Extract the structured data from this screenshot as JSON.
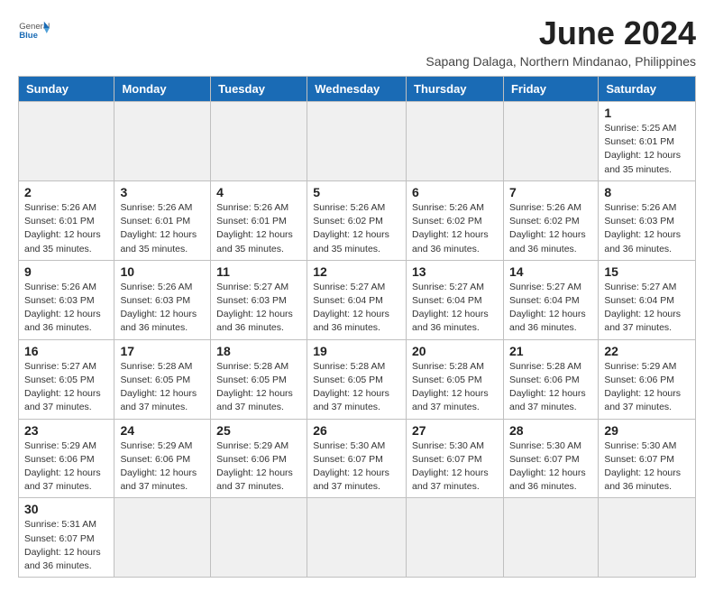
{
  "header": {
    "logo_general": "General",
    "logo_blue": "Blue",
    "month_title": "June 2024",
    "subtitle": "Sapang Dalaga, Northern Mindanao, Philippines"
  },
  "days_of_week": [
    "Sunday",
    "Monday",
    "Tuesday",
    "Wednesday",
    "Thursday",
    "Friday",
    "Saturday"
  ],
  "weeks": [
    [
      {
        "day": "",
        "empty": true
      },
      {
        "day": "",
        "empty": true
      },
      {
        "day": "",
        "empty": true
      },
      {
        "day": "",
        "empty": true
      },
      {
        "day": "",
        "empty": true
      },
      {
        "day": "",
        "empty": true
      },
      {
        "day": "1",
        "sunrise": "5:25 AM",
        "sunset": "6:01 PM",
        "daylight": "12 hours and 35 minutes."
      }
    ],
    [
      {
        "day": "2",
        "sunrise": "5:26 AM",
        "sunset": "6:01 PM",
        "daylight": "12 hours and 35 minutes."
      },
      {
        "day": "3",
        "sunrise": "5:26 AM",
        "sunset": "6:01 PM",
        "daylight": "12 hours and 35 minutes."
      },
      {
        "day": "4",
        "sunrise": "5:26 AM",
        "sunset": "6:01 PM",
        "daylight": "12 hours and 35 minutes."
      },
      {
        "day": "5",
        "sunrise": "5:26 AM",
        "sunset": "6:02 PM",
        "daylight": "12 hours and 35 minutes."
      },
      {
        "day": "6",
        "sunrise": "5:26 AM",
        "sunset": "6:02 PM",
        "daylight": "12 hours and 36 minutes."
      },
      {
        "day": "7",
        "sunrise": "5:26 AM",
        "sunset": "6:02 PM",
        "daylight": "12 hours and 36 minutes."
      },
      {
        "day": "8",
        "sunrise": "5:26 AM",
        "sunset": "6:03 PM",
        "daylight": "12 hours and 36 minutes."
      }
    ],
    [
      {
        "day": "9",
        "sunrise": "5:26 AM",
        "sunset": "6:03 PM",
        "daylight": "12 hours and 36 minutes."
      },
      {
        "day": "10",
        "sunrise": "5:26 AM",
        "sunset": "6:03 PM",
        "daylight": "12 hours and 36 minutes."
      },
      {
        "day": "11",
        "sunrise": "5:27 AM",
        "sunset": "6:03 PM",
        "daylight": "12 hours and 36 minutes."
      },
      {
        "day": "12",
        "sunrise": "5:27 AM",
        "sunset": "6:04 PM",
        "daylight": "12 hours and 36 minutes."
      },
      {
        "day": "13",
        "sunrise": "5:27 AM",
        "sunset": "6:04 PM",
        "daylight": "12 hours and 36 minutes."
      },
      {
        "day": "14",
        "sunrise": "5:27 AM",
        "sunset": "6:04 PM",
        "daylight": "12 hours and 36 minutes."
      },
      {
        "day": "15",
        "sunrise": "5:27 AM",
        "sunset": "6:04 PM",
        "daylight": "12 hours and 37 minutes."
      }
    ],
    [
      {
        "day": "16",
        "sunrise": "5:27 AM",
        "sunset": "6:05 PM",
        "daylight": "12 hours and 37 minutes."
      },
      {
        "day": "17",
        "sunrise": "5:28 AM",
        "sunset": "6:05 PM",
        "daylight": "12 hours and 37 minutes."
      },
      {
        "day": "18",
        "sunrise": "5:28 AM",
        "sunset": "6:05 PM",
        "daylight": "12 hours and 37 minutes."
      },
      {
        "day": "19",
        "sunrise": "5:28 AM",
        "sunset": "6:05 PM",
        "daylight": "12 hours and 37 minutes."
      },
      {
        "day": "20",
        "sunrise": "5:28 AM",
        "sunset": "6:05 PM",
        "daylight": "12 hours and 37 minutes."
      },
      {
        "day": "21",
        "sunrise": "5:28 AM",
        "sunset": "6:06 PM",
        "daylight": "12 hours and 37 minutes."
      },
      {
        "day": "22",
        "sunrise": "5:29 AM",
        "sunset": "6:06 PM",
        "daylight": "12 hours and 37 minutes."
      }
    ],
    [
      {
        "day": "23",
        "sunrise": "5:29 AM",
        "sunset": "6:06 PM",
        "daylight": "12 hours and 37 minutes."
      },
      {
        "day": "24",
        "sunrise": "5:29 AM",
        "sunset": "6:06 PM",
        "daylight": "12 hours and 37 minutes."
      },
      {
        "day": "25",
        "sunrise": "5:29 AM",
        "sunset": "6:06 PM",
        "daylight": "12 hours and 37 minutes."
      },
      {
        "day": "26",
        "sunrise": "5:30 AM",
        "sunset": "6:07 PM",
        "daylight": "12 hours and 37 minutes."
      },
      {
        "day": "27",
        "sunrise": "5:30 AM",
        "sunset": "6:07 PM",
        "daylight": "12 hours and 37 minutes."
      },
      {
        "day": "28",
        "sunrise": "5:30 AM",
        "sunset": "6:07 PM",
        "daylight": "12 hours and 36 minutes."
      },
      {
        "day": "29",
        "sunrise": "5:30 AM",
        "sunset": "6:07 PM",
        "daylight": "12 hours and 36 minutes."
      }
    ],
    [
      {
        "day": "30",
        "sunrise": "5:31 AM",
        "sunset": "6:07 PM",
        "daylight": "12 hours and 36 minutes."
      },
      {
        "day": "",
        "empty": true
      },
      {
        "day": "",
        "empty": true
      },
      {
        "day": "",
        "empty": true
      },
      {
        "day": "",
        "empty": true
      },
      {
        "day": "",
        "empty": true
      },
      {
        "day": "",
        "empty": true
      }
    ]
  ]
}
